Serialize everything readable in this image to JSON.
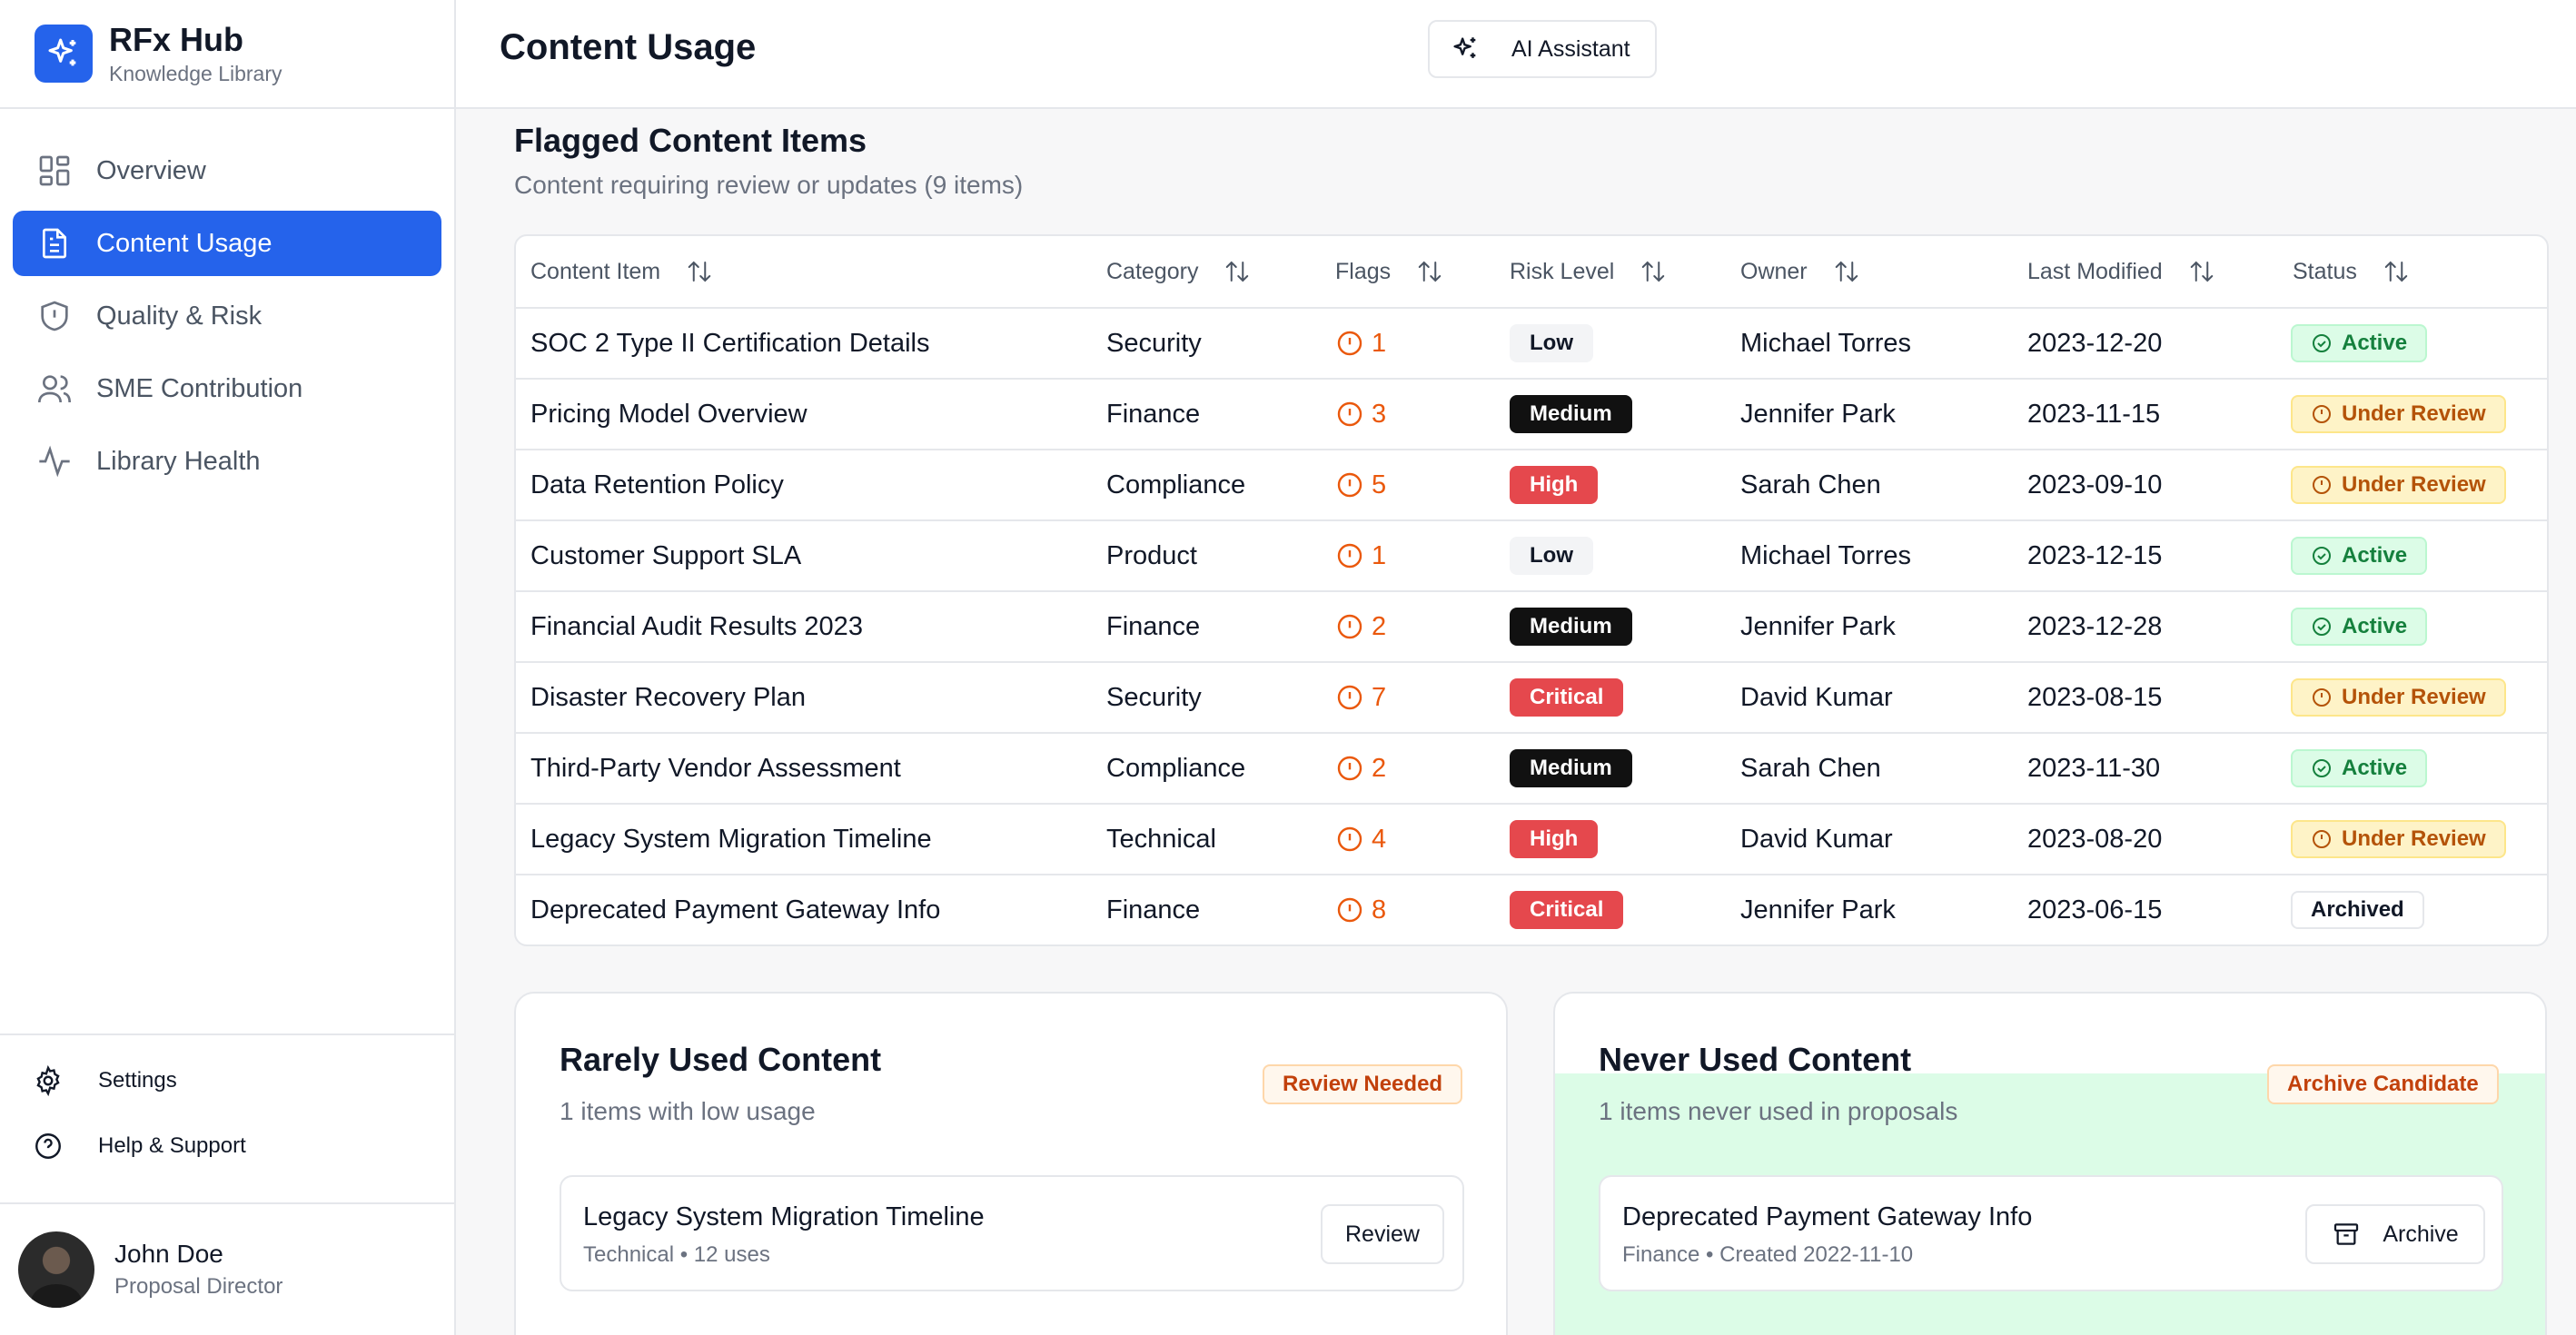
{
  "brand": {
    "title": "RFx Hub",
    "subtitle": "Knowledge Library"
  },
  "nav": [
    {
      "label": "Overview",
      "icon": "grid-icon",
      "active": false
    },
    {
      "label": "Content Usage",
      "icon": "document-icon",
      "active": true
    },
    {
      "label": "Quality & Risk",
      "icon": "shield-icon",
      "active": false
    },
    {
      "label": "SME Contribution",
      "icon": "users-icon",
      "active": false
    },
    {
      "label": "Library Health",
      "icon": "activity-icon",
      "active": false
    }
  ],
  "utility": {
    "settings": "Settings",
    "help": "Help & Support"
  },
  "user": {
    "name": "John Doe",
    "role": "Proposal Director"
  },
  "header": {
    "title": "Content Usage",
    "ai_button": "AI Assistant"
  },
  "flagged": {
    "title": "Flagged Content Items",
    "subtitle": "Content requiring review or updates (9 items)",
    "columns": [
      "Content Item",
      "Category",
      "Flags",
      "Risk Level",
      "Owner",
      "Last Modified",
      "Status"
    ],
    "rows": [
      {
        "item": "SOC 2 Type II Certification Details",
        "category": "Security",
        "flags": "1",
        "risk": "Low",
        "owner": "Michael Torres",
        "modified": "2023-12-20",
        "status": "Active"
      },
      {
        "item": "Pricing Model Overview",
        "category": "Finance",
        "flags": "3",
        "risk": "Medium",
        "owner": "Jennifer Park",
        "modified": "2023-11-15",
        "status": "Under Review"
      },
      {
        "item": "Data Retention Policy",
        "category": "Compliance",
        "flags": "5",
        "risk": "High",
        "owner": "Sarah Chen",
        "modified": "2023-09-10",
        "status": "Under Review"
      },
      {
        "item": "Customer Support SLA",
        "category": "Product",
        "flags": "1",
        "risk": "Low",
        "owner": "Michael Torres",
        "modified": "2023-12-15",
        "status": "Active"
      },
      {
        "item": "Financial Audit Results 2023",
        "category": "Finance",
        "flags": "2",
        "risk": "Medium",
        "owner": "Jennifer Park",
        "modified": "2023-12-28",
        "status": "Active"
      },
      {
        "item": "Disaster Recovery Plan",
        "category": "Security",
        "flags": "7",
        "risk": "Critical",
        "owner": "David Kumar",
        "modified": "2023-08-15",
        "status": "Under Review"
      },
      {
        "item": "Third-Party Vendor Assessment",
        "category": "Compliance",
        "flags": "2",
        "risk": "Medium",
        "owner": "Sarah Chen",
        "modified": "2023-11-30",
        "status": "Active"
      },
      {
        "item": "Legacy System Migration Timeline",
        "category": "Technical",
        "flags": "4",
        "risk": "High",
        "owner": "David Kumar",
        "modified": "2023-08-20",
        "status": "Under Review"
      },
      {
        "item": "Deprecated Payment Gateway Info",
        "category": "Finance",
        "flags": "8",
        "risk": "Critical",
        "owner": "Jennifer Park",
        "modified": "2023-06-15",
        "status": "Archived"
      }
    ]
  },
  "rarely": {
    "title": "Rarely Used Content",
    "subtitle": "1 items with low usage",
    "badge": "Review Needed",
    "item": {
      "title": "Legacy System Migration Timeline",
      "meta": "Technical • 12 uses",
      "button": "Review"
    }
  },
  "never": {
    "title": "Never Used Content",
    "subtitle": "1 items never used in proposals",
    "badge": "Archive Candidate",
    "item": {
      "title": "Deprecated Payment Gateway Info",
      "meta": "Finance • Created 2022-11-10",
      "button": "Archive"
    }
  },
  "colors": {
    "accent": "#2563eb",
    "flag": "#ea580c",
    "danger": "#e5484d"
  }
}
